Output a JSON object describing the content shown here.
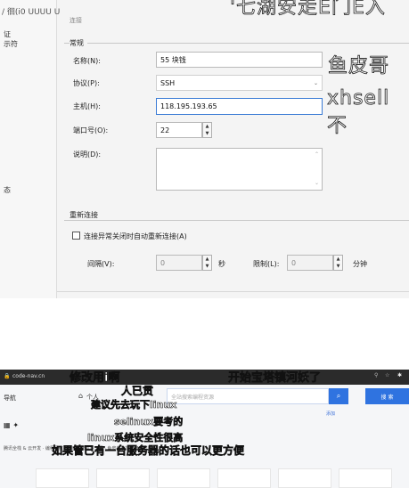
{
  "top_fragment": "/ 徊(i0 UUUU U",
  "top_fragment_right": "'七湖安走E门E入",
  "side_labels": [
    "证",
    "示符",
    "态"
  ],
  "tab_label": "连接",
  "general": {
    "title": "常规",
    "name_label": "名称(N):",
    "name_value": "55 块钱",
    "protocol_label": "协议(P):",
    "protocol_value": "SSH",
    "host_label": "主机(H):",
    "host_value": "118.195.193.65",
    "port_label": "端口号(O):",
    "port_value": "22",
    "desc_label": "说明(D):",
    "desc_value": ""
  },
  "reconnect": {
    "title": "重新连接",
    "checkbox_label": "连接异常关闭时自动重新连接(A)",
    "interval_label": "间隔(V):",
    "interval_value": "0",
    "interval_unit": "秒",
    "limit_label": "限制(L):",
    "limit_value": "0",
    "limit_unit": "分钟"
  },
  "overlays": {
    "fish": "鱼皮哥",
    "xhell": "xhsell不"
  },
  "browser": {
    "url": "code-nav.cn",
    "danmaku_top_left": "修改用i啊",
    "danmaku_top_right": "开始宝塔镇河妖了"
  },
  "web": {
    "nav_label": "导航",
    "personal_label": "个人",
    "search_placeholder": "全站搜索编程资源",
    "search_right_label": "搜 索",
    "hint_right": "添加",
    "notice_text": "腾讯全栈 & 云开发 · 编程导航 · 鱼皮的编程学习圈 · 鱼皮自助加群聊交流群!",
    "danmaku_1": "人已贯",
    "danmaku_2": "建议先去玩下linux",
    "danmaku_3": "selinux要考的",
    "danmaku_4": "linux系统安全性很高",
    "danmaku_5": "如果管已有一台服务器的话也可以更方便"
  }
}
